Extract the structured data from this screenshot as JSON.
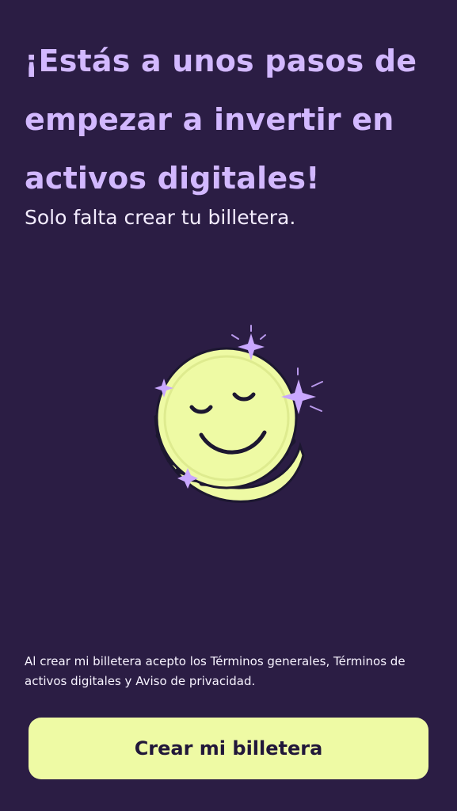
{
  "screen": {
    "headline": "¡Estás a unos pasos de empezar a invertir en activos digitales!",
    "subtitle": "Solo falta crear tu billetera.",
    "illustration_icon": "smiling-coin-icon",
    "legal_text": "Al crear mi billetera acepto los Términos generales, Términos de activos digitales y Aviso de privacidad.",
    "primary_button_label": "Crear mi billetera"
  },
  "colors": {
    "background": "#2b1d44",
    "headline": "#d2b8ff",
    "text": "#f3ecff",
    "button": "#eefaa4",
    "button_text": "#21173a",
    "sparkle": "#c9a7ff"
  }
}
